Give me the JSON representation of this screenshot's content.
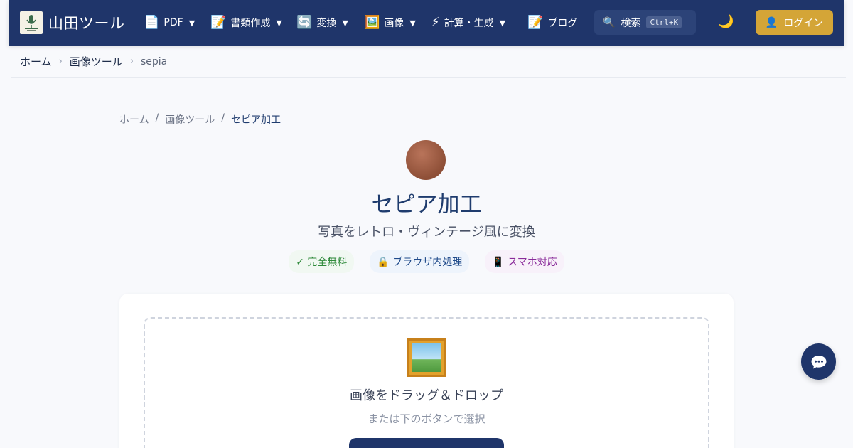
{
  "header": {
    "brand": "山田ツール",
    "nav": [
      {
        "icon": "📄",
        "label": "PDF",
        "caret": "▼"
      },
      {
        "icon": "📝",
        "label": "書類作成",
        "caret": "▼"
      },
      {
        "icon": "🔄",
        "label": "変換",
        "caret": "▼"
      },
      {
        "icon": "🖼️",
        "label": "画像",
        "caret": "▼"
      },
      {
        "icon": "⚡",
        "label": "計算・生成",
        "caret": "▼"
      },
      {
        "icon": "📝",
        "label": "ブログ",
        "caret": ""
      }
    ],
    "search": {
      "icon": "🔍",
      "label": "検索",
      "shortcut": "Ctrl+K"
    },
    "theme_icon": "🌙",
    "login": {
      "icon": "👤",
      "label": "ログイン"
    }
  },
  "breadcrumb_top": {
    "items": [
      "ホーム",
      "画像ツール",
      "sepia"
    ],
    "separator": "›"
  },
  "breadcrumb_inner": {
    "items": [
      "ホーム",
      "画像ツール",
      "セピア加工"
    ],
    "separator": "/"
  },
  "hero": {
    "title": "セピア加工",
    "subtitle": "写真をレトロ・ヴィンテージ風に変換",
    "badges": [
      "✓ 完全無料",
      "🔒 ブラウザ内処理",
      "📱 スマホ対応"
    ]
  },
  "upload": {
    "title": "画像をドラッグ＆ドロップ",
    "subtitle": "または下のボタンで選択"
  },
  "colors": {
    "header_bg": "#1f356a",
    "accent_gold": "#d4a537",
    "title_blue": "#1f3c6e"
  }
}
